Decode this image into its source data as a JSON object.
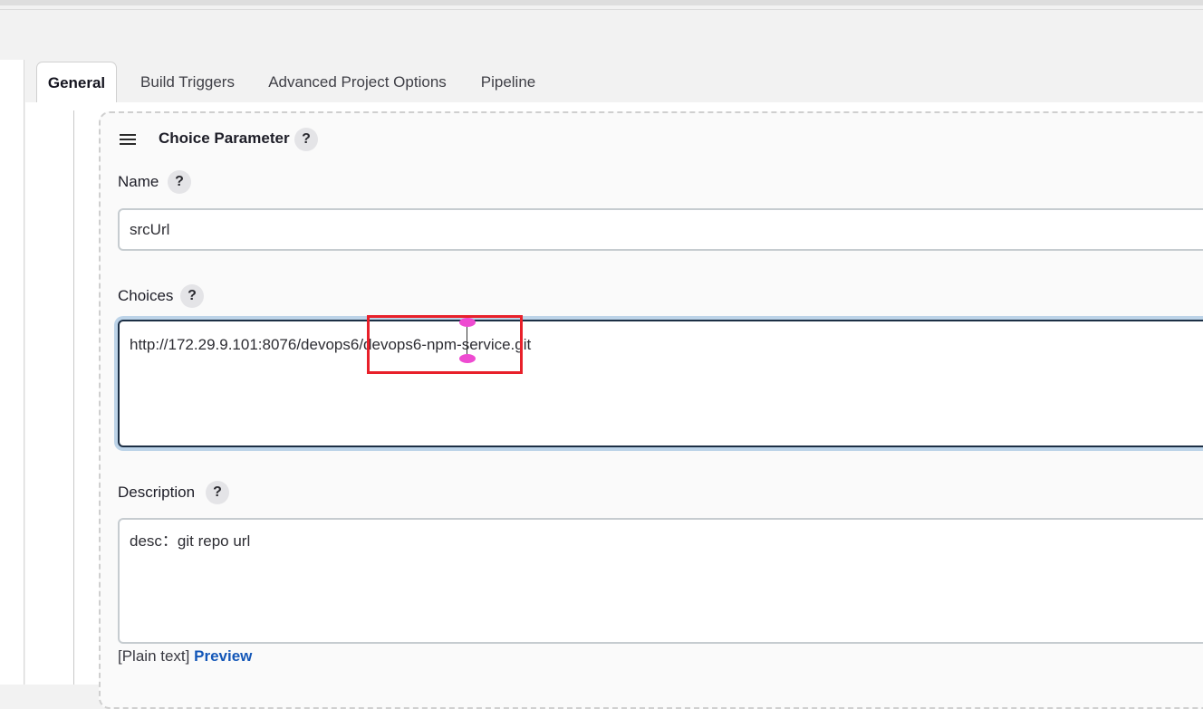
{
  "tabs": [
    {
      "label": "General",
      "active": true
    },
    {
      "label": "Build Triggers",
      "active": false
    },
    {
      "label": "Advanced Project Options",
      "active": false
    },
    {
      "label": "Pipeline",
      "active": false
    }
  ],
  "parameter": {
    "title": "Choice Parameter",
    "help": "?",
    "name_label": "Name",
    "name_value": "srcUrl",
    "choices_label": "Choices",
    "choices_value": "http://172.29.9.101:8076/devops6/devops6-npm-service.git",
    "description_label": "Description",
    "description_value": "desc：git repo url",
    "format_note": "[Plain text]",
    "preview_label": "Preview"
  },
  "colors": {
    "accent_link": "#1457b8",
    "annotation_red": "#e8202a",
    "cursor_magenta": "#ee4bd1",
    "focus_ring": "#bcd3e8"
  },
  "icons": {
    "drag_handle": "hamburger-icon",
    "help": "help-icon"
  }
}
